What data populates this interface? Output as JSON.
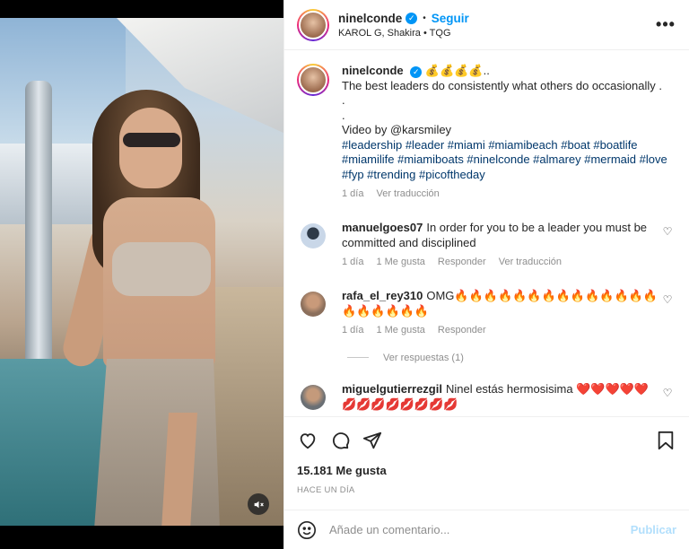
{
  "post": {
    "username": "ninelconde",
    "follow_label": "Seguir",
    "audio": "KAROL G, Shakira • TQG",
    "more_label": "•••"
  },
  "caption": {
    "username": "ninelconde",
    "emoji": "💰💰💰💰..",
    "lines": [
      "The best leaders do consistently what others do occasionally .",
      ".",
      ".",
      "Video by @karsmiley"
    ],
    "hashtags": "#leadership #leader #miami #miamibeach #boat #boatlife #miamilife #miamiboats #ninelconde #almarey #mermaid #love #fyp #trending #picoftheday",
    "time": "1 día",
    "translate": "Ver traducción"
  },
  "comments": [
    {
      "username": "manuelgoes07",
      "text": "In order for you to be a leader you must be committed and disciplined",
      "time": "1 día",
      "likes": "1 Me gusta",
      "reply": "Responder",
      "translate": "Ver traducción",
      "avatar_color": "#c9d7e8"
    },
    {
      "username": "rafa_el_rey310",
      "text": "OMG🔥🔥🔥🔥🔥🔥🔥🔥🔥🔥🔥🔥🔥🔥🔥🔥🔥🔥🔥🔥",
      "time": "1 día",
      "likes": "1 Me gusta",
      "reply": "Responder",
      "avatar_color": "#8b6f5c",
      "view_replies": "Ver respuestas (1)"
    },
    {
      "username": "miguelgutierrezgil",
      "text": "Ninel estás hermosisima ❤️❤️❤️❤️❤️💋💋💋💋💋💋💋💋",
      "avatar_color": "#6a6f74"
    }
  ],
  "actions": {
    "likes": "15.181 Me gusta",
    "time": "HACE UN DÍA"
  },
  "add_comment": {
    "placeholder": "Añade un comentario...",
    "publish": "Publicar"
  },
  "colors": {
    "accent": "#0095f6",
    "link": "#00376b",
    "muted": "#8e8e8e"
  },
  "icons": [
    "mute-icon",
    "verified-icon",
    "more-icon",
    "heart-icon",
    "comment-icon",
    "share-icon",
    "save-icon",
    "emoji-icon"
  ]
}
